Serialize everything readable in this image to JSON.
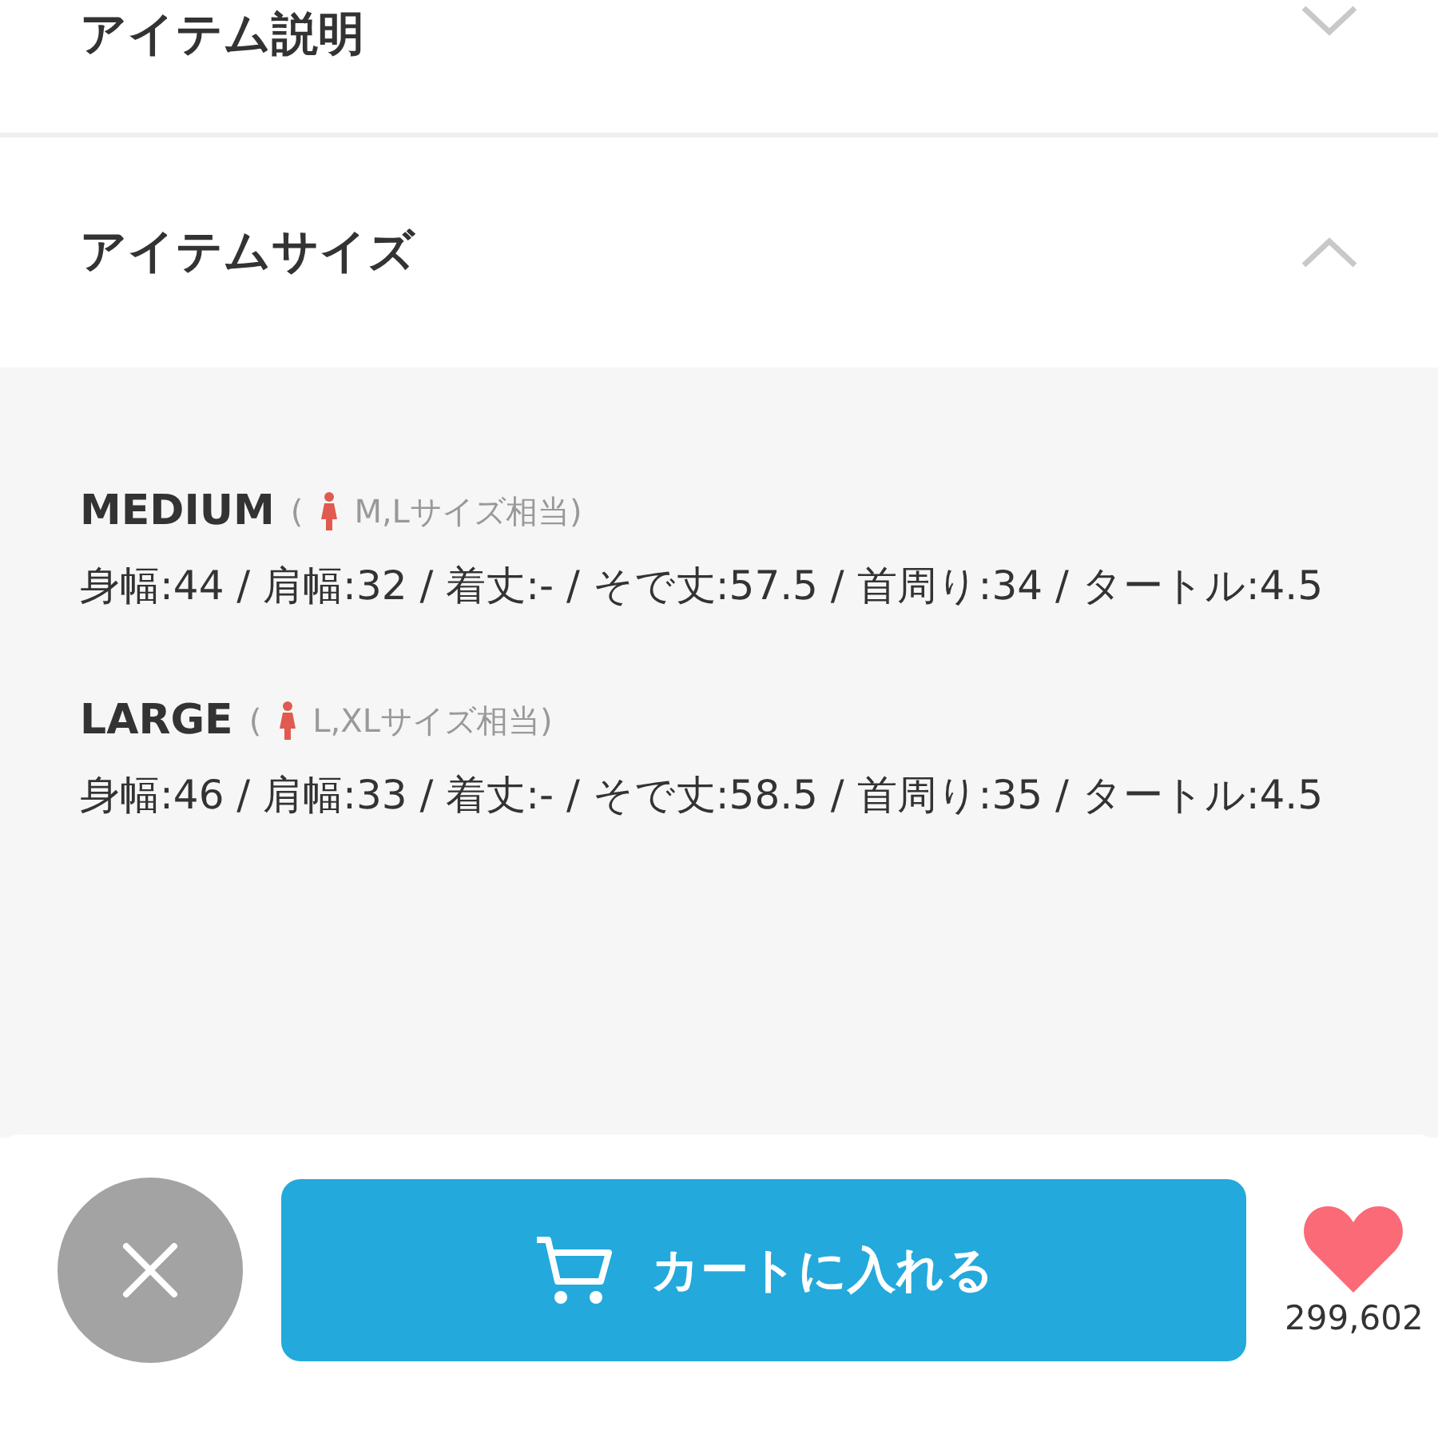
{
  "sections": [
    {
      "title": "アイテム説明",
      "expanded": false
    },
    {
      "title": "アイテムサイズ",
      "expanded": true,
      "sizes": [
        {
          "name": "MEDIUM",
          "note_open": "(",
          "note": "M,Lサイズ相当)",
          "measurements": "身幅:44 / 肩幅:32 / 着丈:- / そで丈:57.5 / 首周り:34 / タートル:4.5"
        },
        {
          "name": "LARGE",
          "note_open": "(",
          "note": "L,XLサイズ相当)",
          "measurements": "身幅:46 / 肩幅:33 / 着丈:- / そで丈:58.5 / 首周り:35 / タートル:4.5"
        }
      ]
    }
  ],
  "bottom_bar": {
    "cart_button": "カートに入れる",
    "favorite_count": "299,602"
  }
}
